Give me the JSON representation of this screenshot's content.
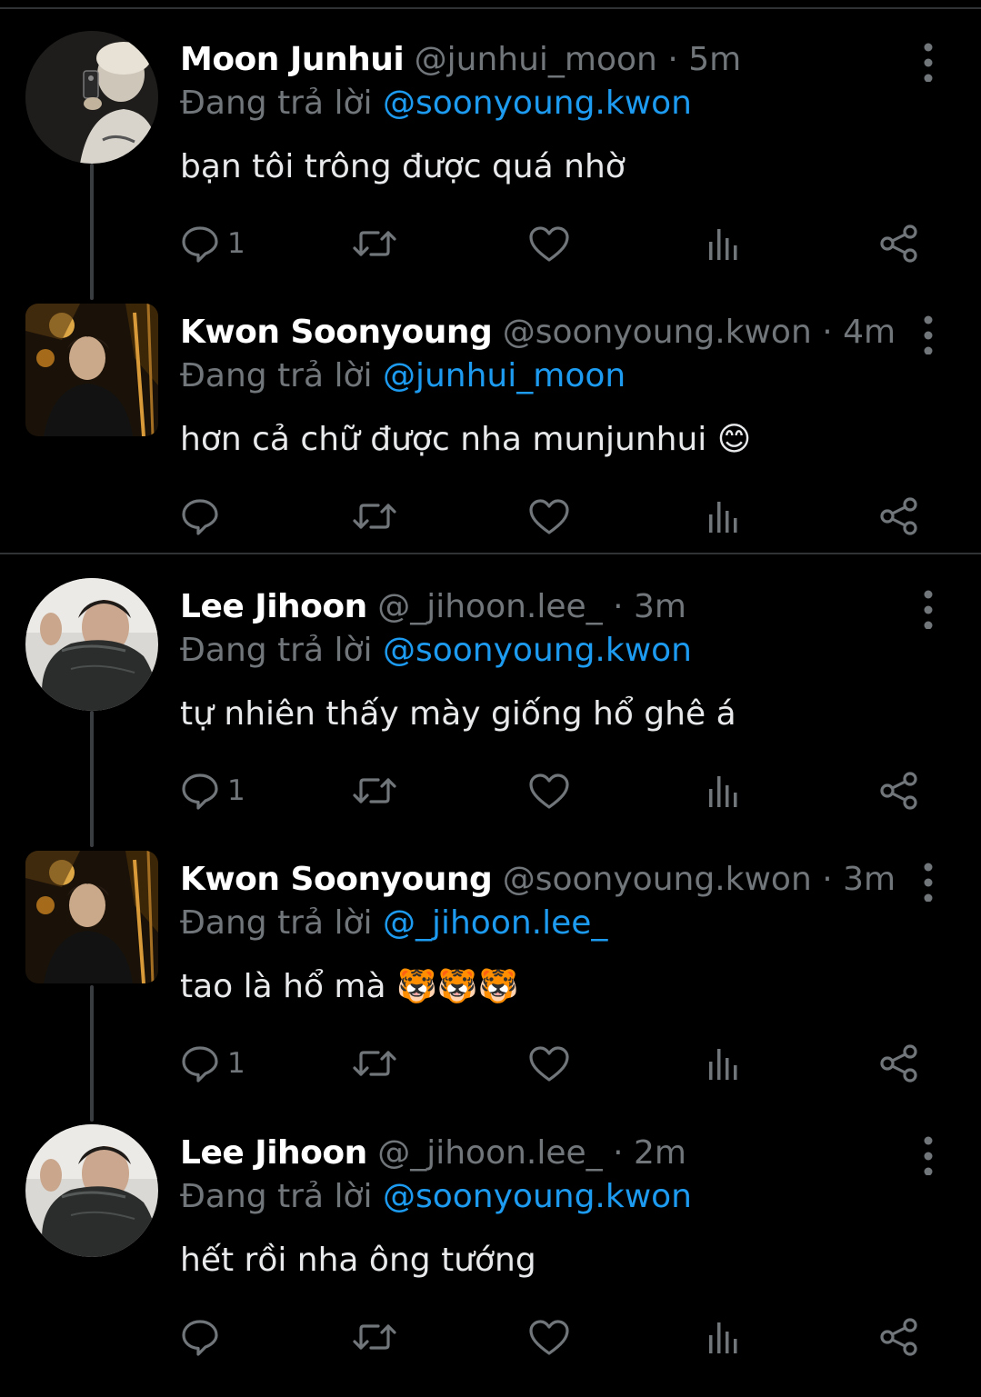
{
  "replying_label": "Đang trả lời",
  "tweets": [
    {
      "name": "Moon Junhui",
      "handle": "@junhui_moon",
      "dot": "·",
      "time": "5m",
      "replying_to": "@soonyoung.kwon",
      "text": "bạn tôi trông được quá nhờ",
      "emoji": "",
      "reply_count": "1"
    },
    {
      "name": "Kwon Soonyoung",
      "handle": "@soonyoung.kwon",
      "dot": "·",
      "time": "4m",
      "replying_to": "@junhui_moon",
      "text": "hơn cả chữ được nha munjunhui",
      "emoji": "😊",
      "reply_count": ""
    },
    {
      "name": "Lee Jihoon",
      "handle": "@_jihoon.lee_",
      "dot": "·",
      "time": "3m",
      "replying_to": "@soonyoung.kwon",
      "text": "tự nhiên thấy mày giống hổ ghê á",
      "emoji": "",
      "reply_count": "1"
    },
    {
      "name": "Kwon Soonyoung",
      "handle": "@soonyoung.kwon",
      "dot": "·",
      "time": "3m",
      "replying_to": "@_jihoon.lee_",
      "text": "tao là hổ mà",
      "emoji": "🐯🐯🐯",
      "reply_count": "1"
    },
    {
      "name": "Lee Jihoon",
      "handle": "@_jihoon.lee_",
      "dot": "·",
      "time": "2m",
      "replying_to": "@soonyoung.kwon",
      "text": "hết rồi nha ông tướng",
      "emoji": "",
      "reply_count": ""
    }
  ],
  "icons": {
    "reply": "reply-icon",
    "retweet": "retweet-icon",
    "like": "heart-icon",
    "views": "views-icon",
    "share": "share-icon",
    "more": "more-vertical-icon"
  },
  "colors": {
    "background": "#000000",
    "text": "#e7e9ea",
    "secondary": "#71767b",
    "link": "#1d9bf0",
    "border": "#2f3336"
  }
}
